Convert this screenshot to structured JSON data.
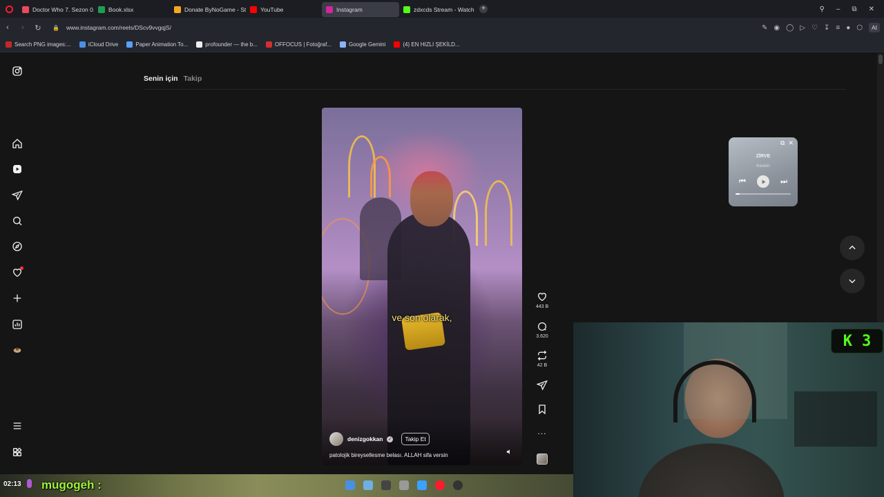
{
  "tabs": [
    {
      "label": "Doctor Who 7. Sezon 0. B",
      "fav": "#e84a5f",
      "w": 110
    },
    {
      "label": "Book.xlsx",
      "fav": "#1f9d55",
      "w": 110
    },
    {
      "label": "Donate ByNoGame - Strea",
      "fav": "#f5a623",
      "w": 110
    },
    {
      "label": "YouTube",
      "fav": "#ff0000",
      "w": 110
    },
    {
      "label": "Instagram",
      "fav": "#d6249f",
      "w": 112,
      "active": true
    },
    {
      "label": "zdxcds Stream - Watch Liv",
      "fav": "#53fc18",
      "w": 110
    }
  ],
  "browser": {
    "url": "www.instagram.com/reels/DScv9vvgqjS/",
    "ai_label": "AI"
  },
  "bookmarks": [
    {
      "label": "Search PNG images:...",
      "fav": "#c62828"
    },
    {
      "label": "iCloud Drive",
      "fav": "#4a90e2"
    },
    {
      "label": "Paper Animation To...",
      "fav": "#5aa0ff"
    },
    {
      "label": "profounder — the b...",
      "fav": "#eeeeee"
    },
    {
      "label": "OFFOCUS | Fotoğraf...",
      "fav": "#d32f2f"
    },
    {
      "label": "Google Gemini",
      "fav": "#8ab4f8"
    },
    {
      "label": "(4) EN HIZLI ŞEKİLD...",
      "fav": "#ff0000"
    }
  ],
  "feed": {
    "tab_for_you": "Senin için",
    "tab_following": "Takip"
  },
  "reel": {
    "caption_overlay": "ve son olarak,",
    "username": "denizgokkan",
    "follow_label": "Takip Et",
    "description": "patolojik bireysellesme belası. ALLAH sifa versin"
  },
  "actions": {
    "likes": "443 B",
    "comments": "3.620",
    "reposts": "42 B",
    "more": "..."
  },
  "mini_player": {
    "title": "ZİRVE",
    "artist": "Keskin",
    "progress": 0.08
  },
  "stream": {
    "time": "02:13",
    "chat_user": "mugogeh :",
    "kick_badge_letter": "K",
    "kick_badge_number": "3"
  },
  "colors": {
    "accent_kick": "#53fc18",
    "notification": "#ff3040",
    "opera_red": "#ff1b2d"
  }
}
